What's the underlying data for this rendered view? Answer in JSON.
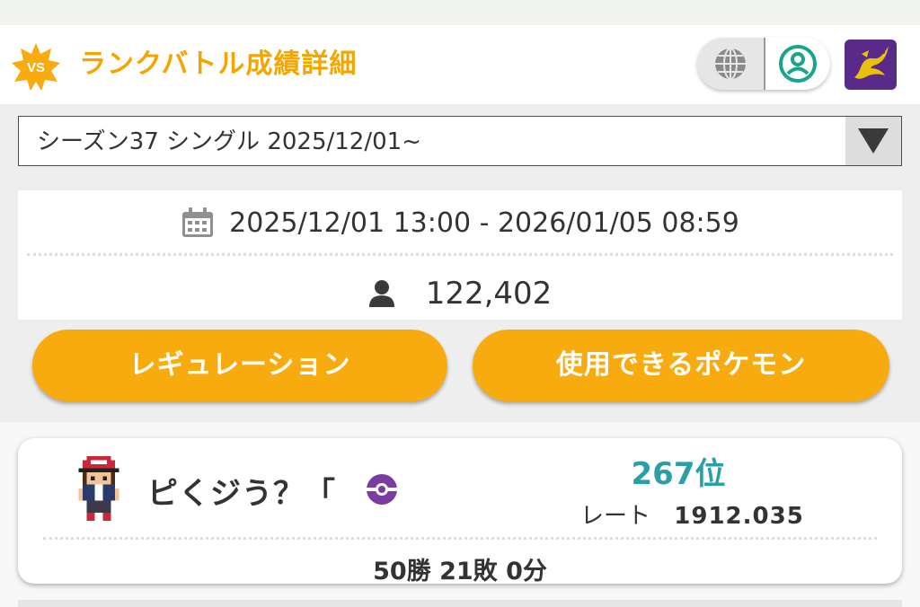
{
  "header": {
    "badge_text": "VS",
    "title": "ランクバトル成績詳細",
    "globe_icon": "globe-icon",
    "account_icon": "account-icon",
    "app_icon": "legendary-dragon-icon"
  },
  "season_select": {
    "selected": "シーズン37 シングル 2025/12/01~"
  },
  "season_info": {
    "period": "2025/12/01 13:00 - 2026/01/05 08:59",
    "players": "122,402"
  },
  "buttons": {
    "regulation": "レギュレーション",
    "usable_pokemon": "使用できるポケモン"
  },
  "player": {
    "name": "ピくジう？「",
    "rank": "267位",
    "rate_label": "レート",
    "rate_value": "1912.035",
    "record": "50勝 21敗 0分"
  },
  "colors": {
    "accent": "#f5a500",
    "button": "#f8ab0e",
    "rank": "#2aa0a6",
    "account_icon": "#1aa58a",
    "ball": "#7a3ca0"
  }
}
